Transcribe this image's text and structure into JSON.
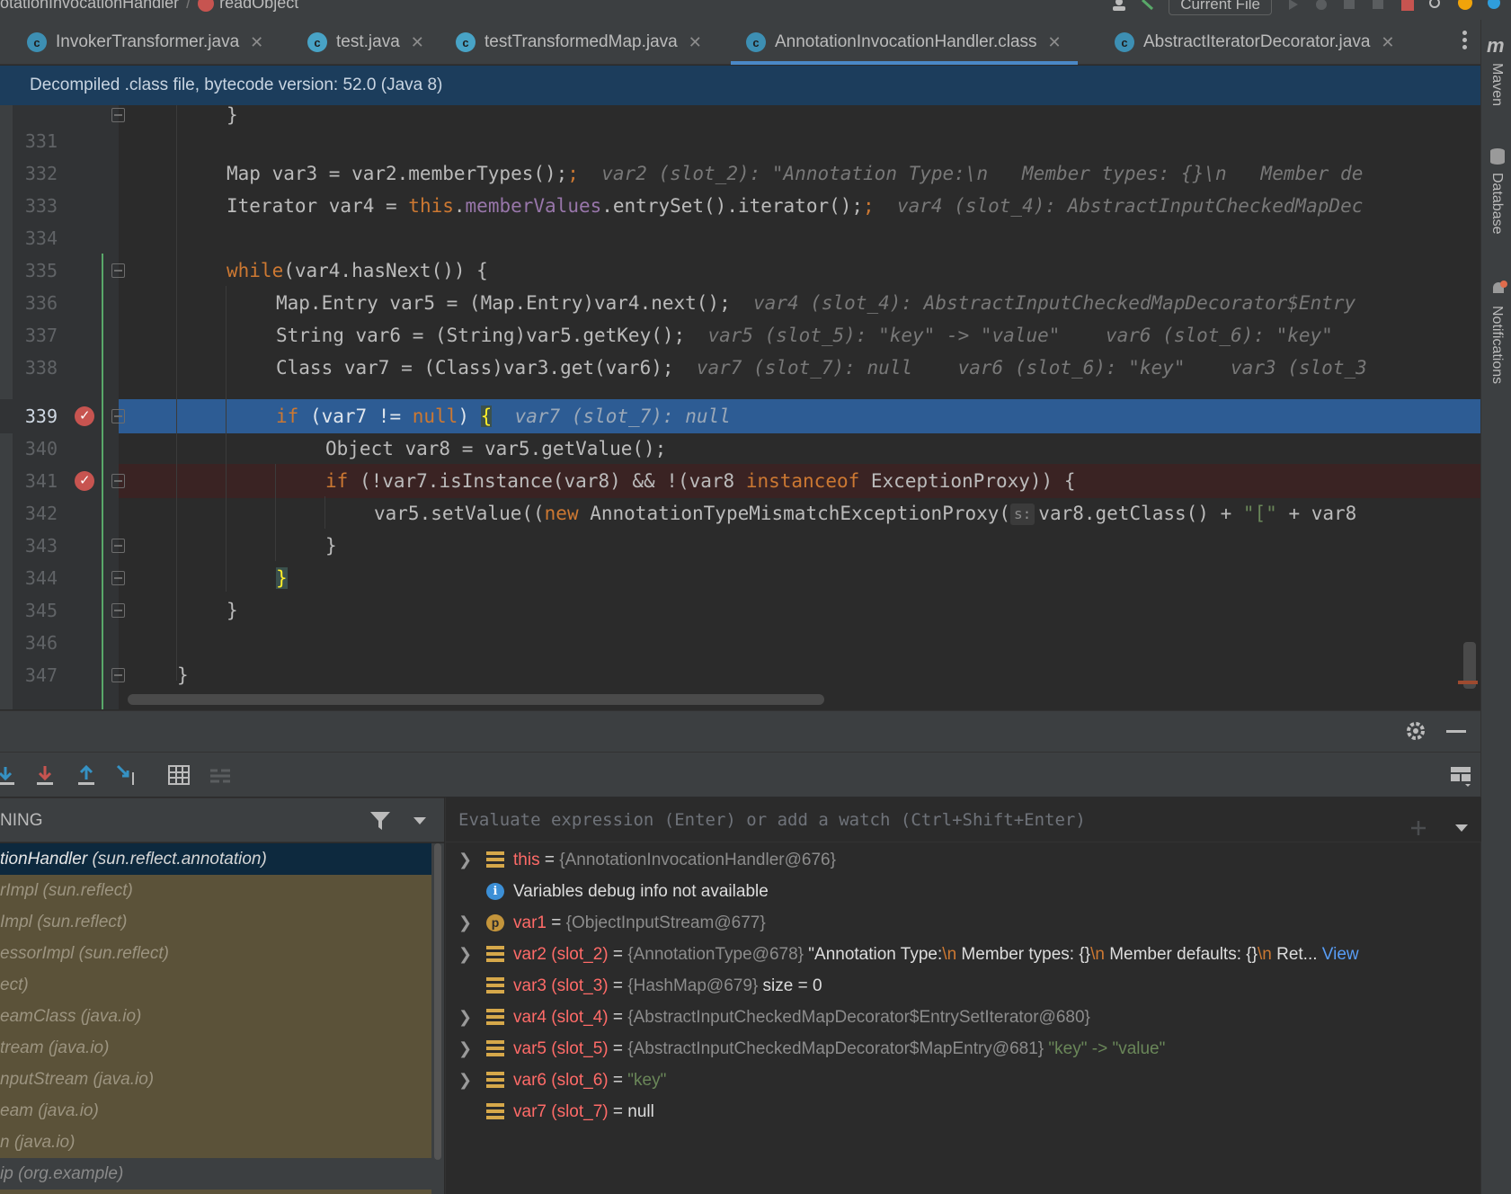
{
  "breadcrumb": {
    "class": "otationInvocationHandler",
    "method": "readObject"
  },
  "toolbar": {
    "run_config": "Current File"
  },
  "tabs": [
    {
      "label": "InvokerTransformer.java",
      "active": false
    },
    {
      "label": "test.java",
      "active": false
    },
    {
      "label": "testTransformedMap.java",
      "active": false
    },
    {
      "label": "AnnotationInvocationHandler.class",
      "active": true
    },
    {
      "label": "AbstractIteratorDecorator.java",
      "active": false
    }
  ],
  "right_strip": {
    "maven": "Maven",
    "database": "Database",
    "notifications": "Notifications"
  },
  "banner": "Decompiled .class file, bytecode version: 52.0 (Java 8)",
  "line_numbers": [
    "331",
    "332",
    "333",
    "334",
    "335",
    "336",
    "337",
    "338",
    "339",
    "340",
    "341",
    "342",
    "343",
    "344",
    "345",
    "346",
    "347"
  ],
  "code": {
    "l332": {
      "text": "Map var3 = var2.memberTypes();",
      "hint": "var2 (slot_2): \"Annotation Type:\\n   Member types: {}\\n   Member de"
    },
    "l333": {
      "pre": "Iterator var4 = ",
      "this": "this",
      "dot": ".",
      "field": "memberValues",
      "post": ".entrySet().iterator();",
      "hint": "var4 (slot_4): AbstractInputCheckedMapDec"
    },
    "l335": {
      "kw": "while",
      "text": "(var4.hasNext()) {"
    },
    "l336": {
      "text": "Map.Entry var5 = (Map.Entry)var4.next();",
      "hint": "var4 (slot_4): AbstractInputCheckedMapDecorator$Entry"
    },
    "l337": {
      "text": "String var6 = (String)var5.getKey();",
      "hint": "var5 (slot_5): \"key\" -> \"value\"    var6 (slot_6): \"key\""
    },
    "l338": {
      "text": "Class var7 = (Class)var3.get(var6);",
      "hint": "var7 (slot_7): null    var6 (slot_6): \"key\"    var3 (slot_3"
    },
    "l339": {
      "kw": "if",
      "text": " (var7 != ",
      "null": "null",
      "close": ") ",
      "brace": "{",
      "hint": "var7 (slot_7): null"
    },
    "l340": {
      "text": "Object var8 = var5.getValue();"
    },
    "l341": {
      "kw": "if",
      "pre": " (!var7.isInstance(var8) && !(var8 ",
      "kw2": "instanceof",
      "post": " ExceptionProxy)) {"
    },
    "l342": {
      "pre": "var5.setValue((",
      "kw": "new",
      "mid": " AnnotationTypeMismatchExceptionProxy(",
      "param": "s:",
      "post": "var8.getClass() + ",
      "str": "\"[\"",
      "tail": " + var8"
    },
    "l343": {
      "text": "}"
    },
    "l344": {
      "brace": "}"
    },
    "l345": {
      "text": "}"
    },
    "l347": {
      "text": "}"
    }
  },
  "frames": {
    "header": "NING",
    "items": [
      {
        "name": "tionHandler",
        "pkg": "(sun.reflect.annotation)",
        "selected": true
      },
      {
        "name": "rImpl",
        "pkg": "(sun.reflect)"
      },
      {
        "name": "Impl",
        "pkg": "(sun.reflect)"
      },
      {
        "name": "essorImpl",
        "pkg": "(sun.reflect)"
      },
      {
        "name": "ect)",
        "pkg": ""
      },
      {
        "name": "eamClass",
        "pkg": "(java.io)"
      },
      {
        "name": "tream",
        "pkg": "(java.io)"
      },
      {
        "name": "nputStream",
        "pkg": "(java.io)"
      },
      {
        "name": "eam",
        "pkg": "(java.io)"
      },
      {
        "name": "n",
        "pkg": "(java.io)"
      },
      {
        "name": "ip",
        "pkg": "(org.example)"
      }
    ]
  },
  "evaluate": {
    "placeholder": "Evaluate expression (Enter) or add a watch (Ctrl+Shift+Enter)"
  },
  "variables": [
    {
      "expandable": true,
      "icon": "field",
      "name": "this",
      "val": "{AnnotationInvocationHandler@676}"
    },
    {
      "expandable": false,
      "icon": "info",
      "text": "Variables debug info not available"
    },
    {
      "expandable": true,
      "icon": "p",
      "name": "var1",
      "val": "{ObjectInputStream@677}"
    },
    {
      "expandable": true,
      "icon": "field",
      "name": "var2 (slot_2)",
      "val": "{AnnotationType@678}",
      "s1": " \"Annotation Type:",
      "e1": "\\n",
      "s2": "   Member types: {}",
      "e2": "\\n",
      "s3": "   Member defaults: {}",
      "e3": "\\n",
      "s4": "   Ret...",
      "link": " View"
    },
    {
      "expandable": false,
      "icon": "field",
      "name": "var3 (slot_3)",
      "val": "{HashMap@679}",
      "extra": "  size = 0"
    },
    {
      "expandable": true,
      "icon": "field",
      "name": "var4 (slot_4)",
      "val": "{AbstractInputCheckedMapDecorator$EntrySetIterator@680}"
    },
    {
      "expandable": true,
      "icon": "field",
      "name": "var5 (slot_5)",
      "val": "{AbstractInputCheckedMapDecorator$MapEntry@681}",
      "str": " \"key\" -> \"value\""
    },
    {
      "expandable": true,
      "icon": "field",
      "name": "var6 (slot_6)",
      "str": "\"key\""
    },
    {
      "expandable": false,
      "icon": "field",
      "name": "var7 (slot_7)",
      "plain": "null"
    }
  ],
  "colors": {
    "accent": "#4a88c7",
    "highlight_line": "#2d5c94",
    "breakpoint": "#c75450",
    "banner": "#1c3d5c",
    "frames_bg": "#5b5239"
  }
}
